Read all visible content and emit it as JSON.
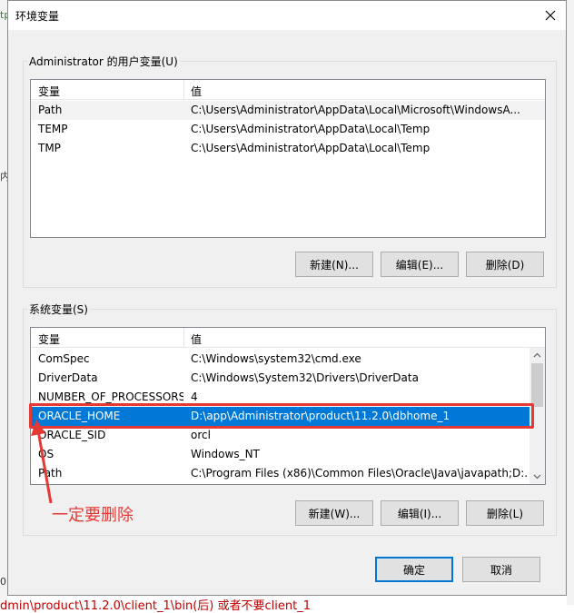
{
  "background": {
    "left_texts": [
      "tp",
      "内",
      "0"
    ],
    "bottom_text": "dmin\\product\\11.2.0\\client_1\\bin(后) 或者不要client_1"
  },
  "window": {
    "title": "环境变量"
  },
  "user_vars": {
    "legend": "Administrator 的用户变量(U)",
    "col_name": "变量",
    "col_value": "值",
    "rows": [
      {
        "name": "Path",
        "value": "C:\\Users\\Administrator\\AppData\\Local\\Microsoft\\WindowsA..."
      },
      {
        "name": "TEMP",
        "value": "C:\\Users\\Administrator\\AppData\\Local\\Temp"
      },
      {
        "name": "TMP",
        "value": "C:\\Users\\Administrator\\AppData\\Local\\Temp"
      }
    ],
    "new_label": "新建(N)...",
    "edit_label": "编辑(E)...",
    "delete_label": "删除(D)"
  },
  "system_vars": {
    "legend": "系统变量(S)",
    "col_name": "变量",
    "col_value": "值",
    "rows": [
      {
        "name": "ComSpec",
        "value": "C:\\Windows\\system32\\cmd.exe"
      },
      {
        "name": "DriverData",
        "value": "C:\\Windows\\System32\\Drivers\\DriverData"
      },
      {
        "name": "NUMBER_OF_PROCESSORS",
        "value": "4"
      },
      {
        "name": "ORACLE_HOME",
        "value": "D:\\app\\Administrator\\product\\11.2.0\\dbhome_1"
      },
      {
        "name": "ORACLE_SID",
        "value": "orcl"
      },
      {
        "name": "OS",
        "value": "Windows_NT"
      },
      {
        "name": "Path",
        "value": "C:\\Program Files (x86)\\Common Files\\Oracle\\Java\\javapath;D:..."
      }
    ],
    "selected_index": 3,
    "new_label": "新建(W)...",
    "edit_label": "编辑(I)...",
    "delete_label": "删除(L)"
  },
  "annotation": {
    "text": "一定要删除",
    "color": "#e53935"
  },
  "footer": {
    "ok_label": "确定",
    "cancel_label": "取消"
  },
  "icons": {
    "close": "close-icon",
    "scroll_up": "chevron-up-icon",
    "scroll_down": "chevron-down-icon"
  },
  "colors": {
    "selection": "#0078d7",
    "accent": "#0078d7"
  }
}
